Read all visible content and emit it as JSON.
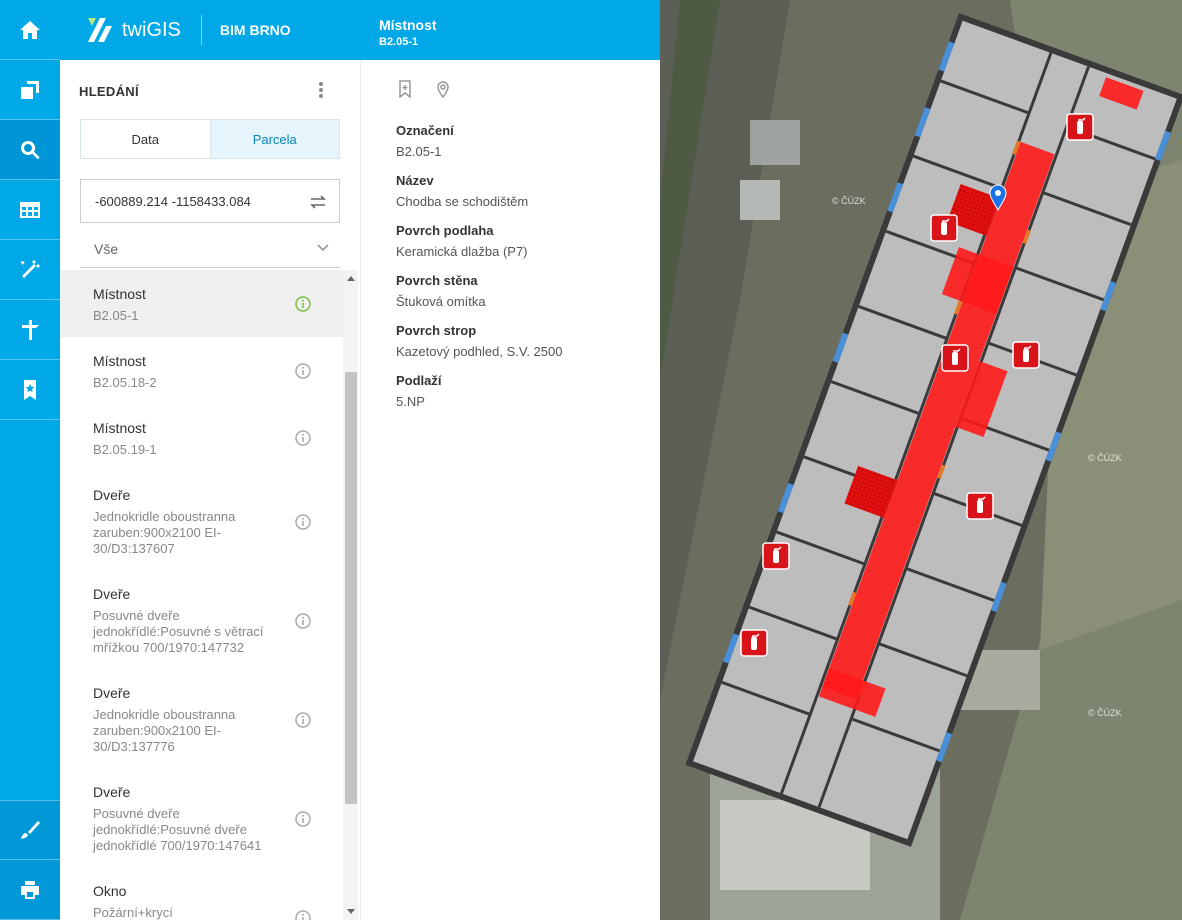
{
  "app": {
    "logo_text": "twiGIS",
    "project": "BIM BRNO"
  },
  "rail": {
    "icons": [
      "home-icon",
      "layers-icon",
      "search-icon",
      "table-icon",
      "measure-icon",
      "tools-icon",
      "bookmark-icon",
      "eraser-icon",
      "print-icon"
    ]
  },
  "search_panel": {
    "title": "HLEDÁNÍ",
    "tabs": [
      {
        "label": "Data"
      },
      {
        "label": "Parcela",
        "active": true
      }
    ],
    "coordinate_input": "-600889.214 -1158433.084",
    "filter": "Vše",
    "results": [
      {
        "type": "Místnost",
        "name": "B2.05-1",
        "selected": true
      },
      {
        "type": "Místnost",
        "name": "B2.05.18-2"
      },
      {
        "type": "Místnost",
        "name": "B2.05.19-1"
      },
      {
        "type": "Dveře",
        "name": "Jednokridle oboustranna zaruben:900x2100 EI-30/D3:137607"
      },
      {
        "type": "Dveře",
        "name": "Posuvné dveře jednokřídlé:Posuvné s větrací mřížkou 700/1970:147732"
      },
      {
        "type": "Dveře",
        "name": "Jednokridle oboustranna zaruben:900x2100 EI-30/D3:137776"
      },
      {
        "type": "Dveře",
        "name": "Posuvné dveře jednokřídlé:Posuvné dveře jednokřídlé 700/1970:147641"
      },
      {
        "type": "Okno",
        "name": "Požární+krycí"
      }
    ]
  },
  "detail": {
    "title": "Místnost",
    "subtitle": "B2.05-1",
    "close_label": "×",
    "attributes": [
      {
        "label": "Označení",
        "value": "B2.05-1"
      },
      {
        "label": "Název",
        "value": "Chodba se schodištěm"
      },
      {
        "label": "Povrch podlaha",
        "value": "Keramická dlažba (P7)"
      },
      {
        "label": "Povrch stěna",
        "value": "Štuková omítka"
      },
      {
        "label": "Povrch strop",
        "value": "Kazetový podhled, S.V. 2500"
      },
      {
        "label": "Podlaží",
        "value": "5.NP"
      }
    ]
  },
  "map": {
    "watermark": "© ČÚZK",
    "colors": {
      "selected_room": "#ff1a1a",
      "rooms": "#bdbdbd",
      "windows": "#4a90d9",
      "doors": "#e07a2a",
      "extinguisher": "#d8141a",
      "marker": "#1a73e8"
    }
  }
}
